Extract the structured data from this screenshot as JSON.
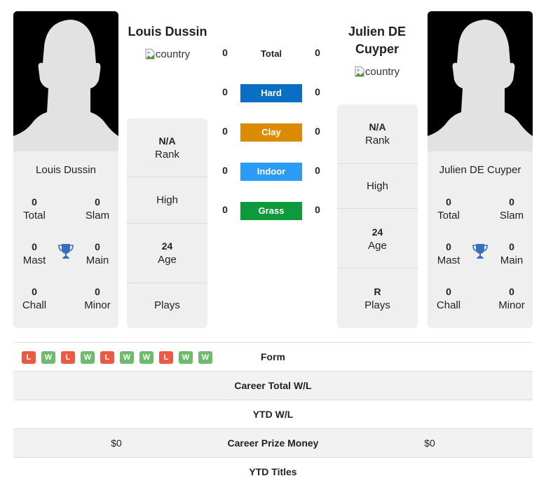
{
  "player1": {
    "name": "Louis Dussin",
    "card_name": "Louis Dussin",
    "flag_alt": "country",
    "titles": {
      "total": {
        "value": "0",
        "label": "Total"
      },
      "slam": {
        "value": "0",
        "label": "Slam"
      },
      "mast": {
        "value": "0",
        "label": "Mast"
      },
      "main": {
        "value": "0",
        "label": "Main"
      },
      "chall": {
        "value": "0",
        "label": "Chall"
      },
      "minor": {
        "value": "0",
        "label": "Minor"
      }
    },
    "info": {
      "rank": {
        "value": "N/A",
        "label": "Rank"
      },
      "high": {
        "value": "",
        "label": "High"
      },
      "age": {
        "value": "24",
        "label": "Age"
      },
      "plays": {
        "value": "",
        "label": "Plays"
      }
    }
  },
  "player2": {
    "name": "Julien DE Cuyper",
    "card_name": "Julien DE Cuyper",
    "flag_alt": "country",
    "titles": {
      "total": {
        "value": "0",
        "label": "Total"
      },
      "slam": {
        "value": "0",
        "label": "Slam"
      },
      "mast": {
        "value": "0",
        "label": "Mast"
      },
      "main": {
        "value": "0",
        "label": "Main"
      },
      "chall": {
        "value": "0",
        "label": "Chall"
      },
      "minor": {
        "value": "0",
        "label": "Minor"
      }
    },
    "info": {
      "rank": {
        "value": "N/A",
        "label": "Rank"
      },
      "high": {
        "value": "",
        "label": "High"
      },
      "age": {
        "value": "24",
        "label": "Age"
      },
      "plays": {
        "value": "R",
        "label": "Plays"
      }
    }
  },
  "h2h": {
    "total": {
      "label": "Total",
      "p1": "0",
      "p2": "0"
    },
    "surfaces": [
      {
        "label": "Hard",
        "p1": "0",
        "p2": "0",
        "color": "#0a6ec2"
      },
      {
        "label": "Clay",
        "p1": "0",
        "p2": "0",
        "color": "#dc8c04"
      },
      {
        "label": "Indoor",
        "p1": "0",
        "p2": "0",
        "color": "#2b9cf5"
      },
      {
        "label": "Grass",
        "p1": "0",
        "p2": "0",
        "color": "#0e9a3c"
      }
    ]
  },
  "comparison": {
    "form": {
      "label": "Form",
      "p1": [
        "L",
        "W",
        "L",
        "W",
        "L",
        "W",
        "W",
        "L",
        "W",
        "W"
      ]
    },
    "rows": [
      {
        "label": "Career Total W/L",
        "p1": "",
        "p2": ""
      },
      {
        "label": "YTD W/L",
        "p1": "",
        "p2": ""
      },
      {
        "label": "Career Prize Money",
        "p1": "$0",
        "p2": "$0"
      },
      {
        "label": "YTD Titles",
        "p1": "",
        "p2": ""
      }
    ]
  },
  "colors": {
    "win": "#6ebb6e",
    "loss": "#ea5a44",
    "trophy": "#3a6fbf",
    "card_bg": "#efefef"
  }
}
